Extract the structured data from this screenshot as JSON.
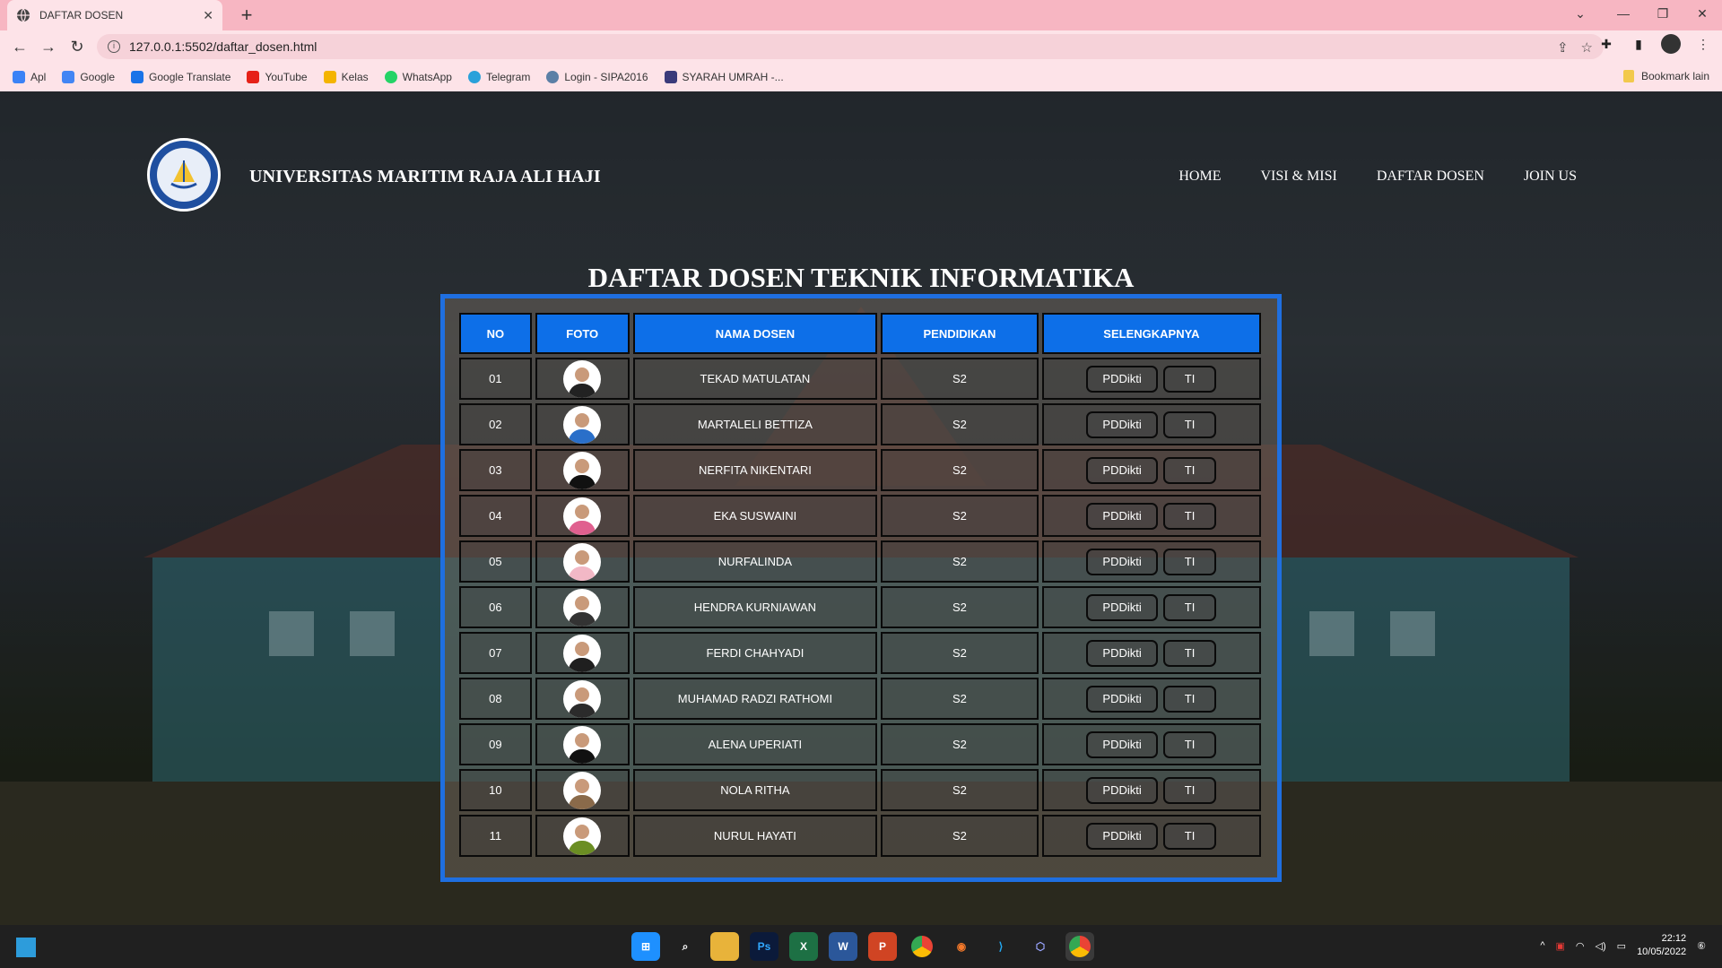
{
  "browser": {
    "tab_title": "DAFTAR DOSEN",
    "url": "127.0.0.1:5502/daftar_dosen.html",
    "bookmarks": [
      "Apl",
      "Google",
      "Google Translate",
      "YouTube",
      "Kelas",
      "WhatsApp",
      "Telegram",
      "Login - SIPA2016",
      "SYARAH UMRAH -..."
    ],
    "bookmark_other": "Bookmark lain",
    "accent": "#f7b6c2"
  },
  "site": {
    "brand": "UNIVERSITAS MARITIM RAJA ALI HAJI",
    "nav": [
      "HOME",
      "VISI & MISI",
      "DAFTAR DOSEN",
      "JOIN US"
    ],
    "title": "DAFTAR DOSEN TEKNIK INFORMATIKA"
  },
  "table": {
    "headers": [
      "NO",
      "FOTO",
      "NAMA DOSEN",
      "PENDIDIKAN",
      "SELENGKAPNYA"
    ],
    "rows": [
      {
        "no": "01",
        "name": "TEKAD MATULATAN",
        "edu": "S2",
        "btn1": "PDDikti",
        "btn2": "TI",
        "photo_color": "#222222"
      },
      {
        "no": "02",
        "name": "MARTALELI BETTIZA",
        "edu": "S2",
        "btn1": "PDDikti",
        "btn2": "TI",
        "photo_color": "#2a6fc9"
      },
      {
        "no": "03",
        "name": "NERFITA NIKENTARI",
        "edu": "S2",
        "btn1": "PDDikti",
        "btn2": "TI",
        "photo_color": "#111111"
      },
      {
        "no": "04",
        "name": "EKA SUSWAINI",
        "edu": "S2",
        "btn1": "PDDikti",
        "btn2": "TI",
        "photo_color": "#e0608f"
      },
      {
        "no": "05",
        "name": "NURFALINDA",
        "edu": "S2",
        "btn1": "PDDikti",
        "btn2": "TI",
        "photo_color": "#f2b8c6"
      },
      {
        "no": "06",
        "name": "HENDRA KURNIAWAN",
        "edu": "S2",
        "btn1": "PDDikti",
        "btn2": "TI",
        "photo_color": "#333333"
      },
      {
        "no": "07",
        "name": "FERDI CHAHYADI",
        "edu": "S2",
        "btn1": "PDDikti",
        "btn2": "TI",
        "photo_color": "#1f1f1f"
      },
      {
        "no": "08",
        "name": "MUHAMAD RADZI RATHOMI",
        "edu": "S2",
        "btn1": "PDDikti",
        "btn2": "TI",
        "photo_color": "#2b2b2b"
      },
      {
        "no": "09",
        "name": "ALENA UPERIATI",
        "edu": "S2",
        "btn1": "PDDikti",
        "btn2": "TI",
        "photo_color": "#111111"
      },
      {
        "no": "10",
        "name": "NOLA RITHA",
        "edu": "S2",
        "btn1": "PDDikti",
        "btn2": "TI",
        "photo_color": "#8a6a4a"
      },
      {
        "no": "11",
        "name": "NURUL HAYATI",
        "edu": "S2",
        "btn1": "PDDikti",
        "btn2": "TI",
        "photo_color": "#6b8e23"
      }
    ]
  },
  "taskbar": {
    "time": "22:12",
    "date": "10/05/2022"
  },
  "colors": {
    "table_frame": "#1f6fe0",
    "header_cell": "#0d6fe8"
  }
}
